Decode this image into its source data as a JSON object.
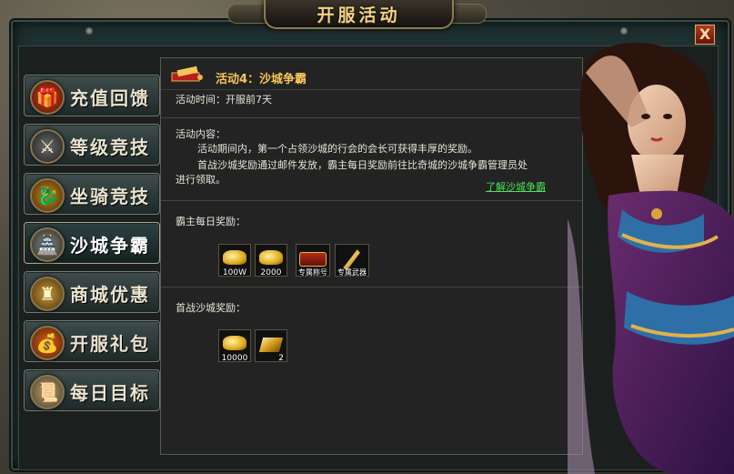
{
  "window": {
    "title": "开服活动",
    "close_label": "X"
  },
  "menu": [
    {
      "label": "充值回馈",
      "icon": "gift-box-icon",
      "active": false
    },
    {
      "label": "等级竞技",
      "icon": "crossed-swords-icon",
      "active": false
    },
    {
      "label": "坐骑竞技",
      "icon": "dragon-mount-icon",
      "active": false
    },
    {
      "label": "沙城争霸",
      "icon": "castle-icon",
      "active": true
    },
    {
      "label": "商城优惠",
      "icon": "shop-chest-icon",
      "active": false
    },
    {
      "label": "开服礼包",
      "icon": "gift-bag-icon",
      "active": false
    },
    {
      "label": "每日目标",
      "icon": "scroll-target-icon",
      "active": false
    }
  ],
  "activity": {
    "title": "活动4：沙城争霸",
    "time": "活动时间：开服前7天",
    "content_label": "活动内容：",
    "content_line1": "活动期间内，第一个占领沙城的行会的会长可获得丰厚的奖励。",
    "content_line2a": "首战沙城奖励通过邮件发放，霸主每日奖励前往比奇城的沙城争霸管理员处",
    "content_line2b": "进行领取。",
    "link": "了解沙城争霸",
    "daily_label": "霸主每日奖励：",
    "daily_rewards": [
      {
        "icon": "gold-ingot-icon",
        "qty": "100W"
      },
      {
        "icon": "gold-ingot-icon",
        "qty": "2000"
      },
      {
        "icon": "title-plaque-icon",
        "qty": "专属称号"
      },
      {
        "icon": "weapon-icon",
        "qty": "专属武器"
      }
    ],
    "first_label": "首战沙城奖励：",
    "first_rewards": [
      {
        "icon": "gold-ingot-icon",
        "qty": "10000"
      },
      {
        "icon": "gold-bar-icon",
        "qty": "2"
      }
    ]
  },
  "colors": {
    "accent_gold": "#f5c657",
    "link_green": "#4be05a",
    "panel_bg": "#232323"
  }
}
